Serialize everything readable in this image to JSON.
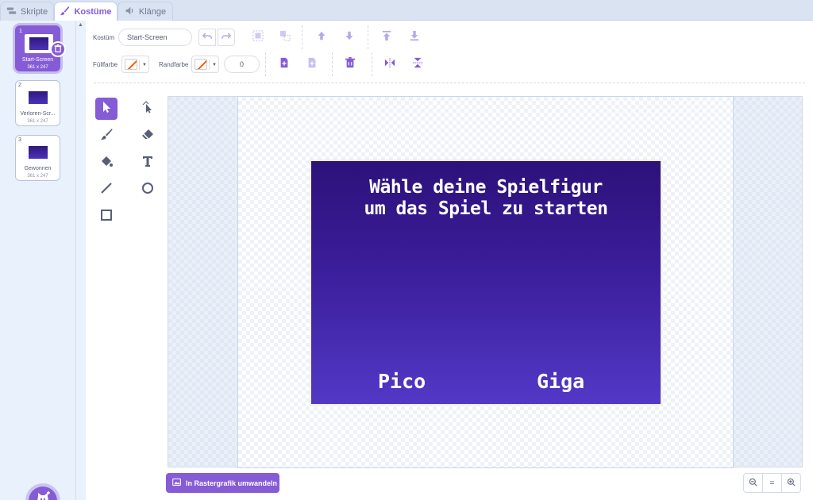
{
  "tabs": [
    {
      "label": "Skripte",
      "icon": "code-icon"
    },
    {
      "label": "Kostüme",
      "icon": "brush-icon"
    },
    {
      "label": "Klänge",
      "icon": "speaker-icon"
    }
  ],
  "costumes": [
    {
      "num": "1",
      "name": "Start-Screen",
      "size": "361 x 247",
      "selected": true
    },
    {
      "num": "2",
      "name": "Verloren-Scr...",
      "size": "361 x 247",
      "selected": false
    },
    {
      "num": "3",
      "name": "Gewonnen",
      "size": "361 x 247",
      "selected": false
    }
  ],
  "toolbar": {
    "costume_label": "Kostüm",
    "costume_name": "Start-Screen",
    "fill_label": "Füllfarbe",
    "outline_label": "Randfarbe",
    "stroke_width": "0",
    "fill_color": "none",
    "outline_color": "none"
  },
  "canvas": {
    "title": "Wähle deine Spielfigur\num das Spiel zu starten",
    "option_left": "Pico",
    "option_right": "Giga"
  },
  "bottom": {
    "convert_label": "In Rastergrafik umwandeln",
    "zoom_reset": "="
  },
  "colors": {
    "accent": "#855cd6",
    "costume_bg_top": "#2d117a",
    "costume_bg_bottom": "#5238c6"
  }
}
